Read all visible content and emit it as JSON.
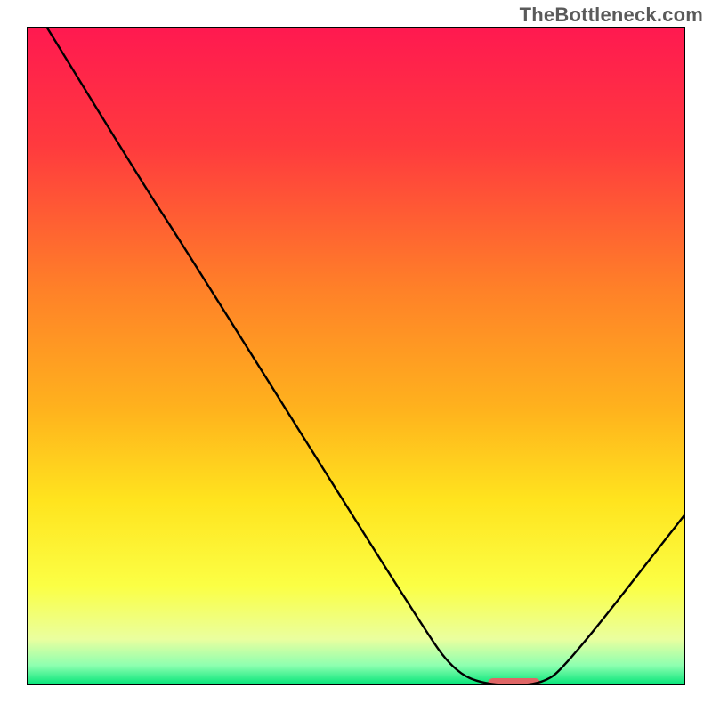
{
  "watermark": "TheBottleneck.com",
  "chart_data": {
    "type": "line",
    "title": "",
    "xlabel": "",
    "ylabel": "",
    "xlim": [
      0,
      100
    ],
    "ylim": [
      0,
      100
    ],
    "grid": false,
    "background_gradient": {
      "stops": [
        {
          "offset": 0,
          "color": "#ff1950"
        },
        {
          "offset": 18,
          "color": "#ff3a3e"
        },
        {
          "offset": 40,
          "color": "#ff8128"
        },
        {
          "offset": 58,
          "color": "#ffb21d"
        },
        {
          "offset": 72,
          "color": "#ffe41e"
        },
        {
          "offset": 85,
          "color": "#fbff45"
        },
        {
          "offset": 93,
          "color": "#eaff9f"
        },
        {
          "offset": 97,
          "color": "#8dffb0"
        },
        {
          "offset": 100,
          "color": "#00e477"
        }
      ]
    },
    "series": [
      {
        "name": "bottleneck-curve",
        "stroke": "#000000",
        "points": [
          {
            "x": 3,
            "y": 100
          },
          {
            "x": 19,
            "y": 74
          },
          {
            "x": 23,
            "y": 68
          },
          {
            "x": 60,
            "y": 9
          },
          {
            "x": 65,
            "y": 2
          },
          {
            "x": 70,
            "y": 0
          },
          {
            "x": 78,
            "y": 0
          },
          {
            "x": 82,
            "y": 3
          },
          {
            "x": 100,
            "y": 26
          }
        ]
      }
    ],
    "marker": {
      "name": "optimal-range",
      "x_center": 74,
      "y": 0,
      "width": 8,
      "color": "#e06666"
    },
    "axes": {
      "border_color": "#000000",
      "border_width": 2
    }
  }
}
